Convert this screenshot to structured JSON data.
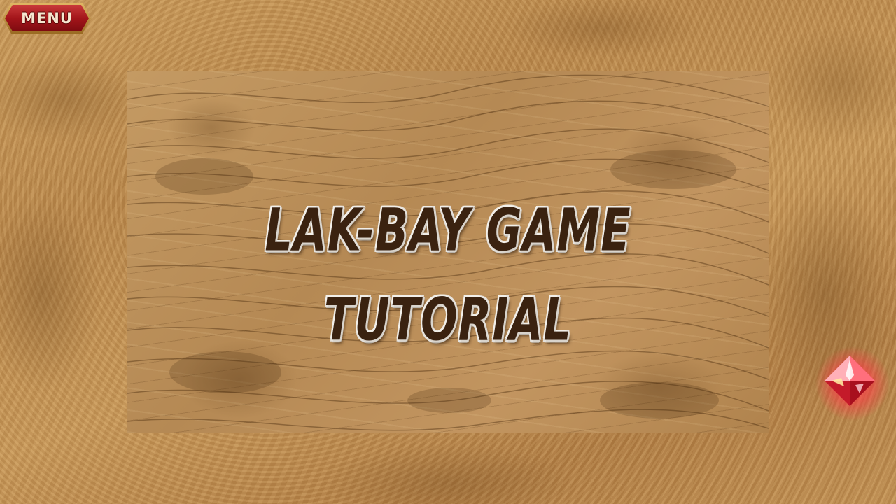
{
  "menu_button": {
    "label": "MENU"
  },
  "title": {
    "line1": "Lak-Bay Game",
    "line2": "Tutorial"
  },
  "next_button": {
    "icon": "red-crystal-gem-icon"
  },
  "colors": {
    "wood_background": "#c0904f",
    "panel": "#bd9059",
    "title_text": "#3a2210",
    "title_outline": "#e6e2dc",
    "menu_red": "#a3151a",
    "menu_gold": "#d4a550",
    "gem_red": "#ff4655"
  }
}
